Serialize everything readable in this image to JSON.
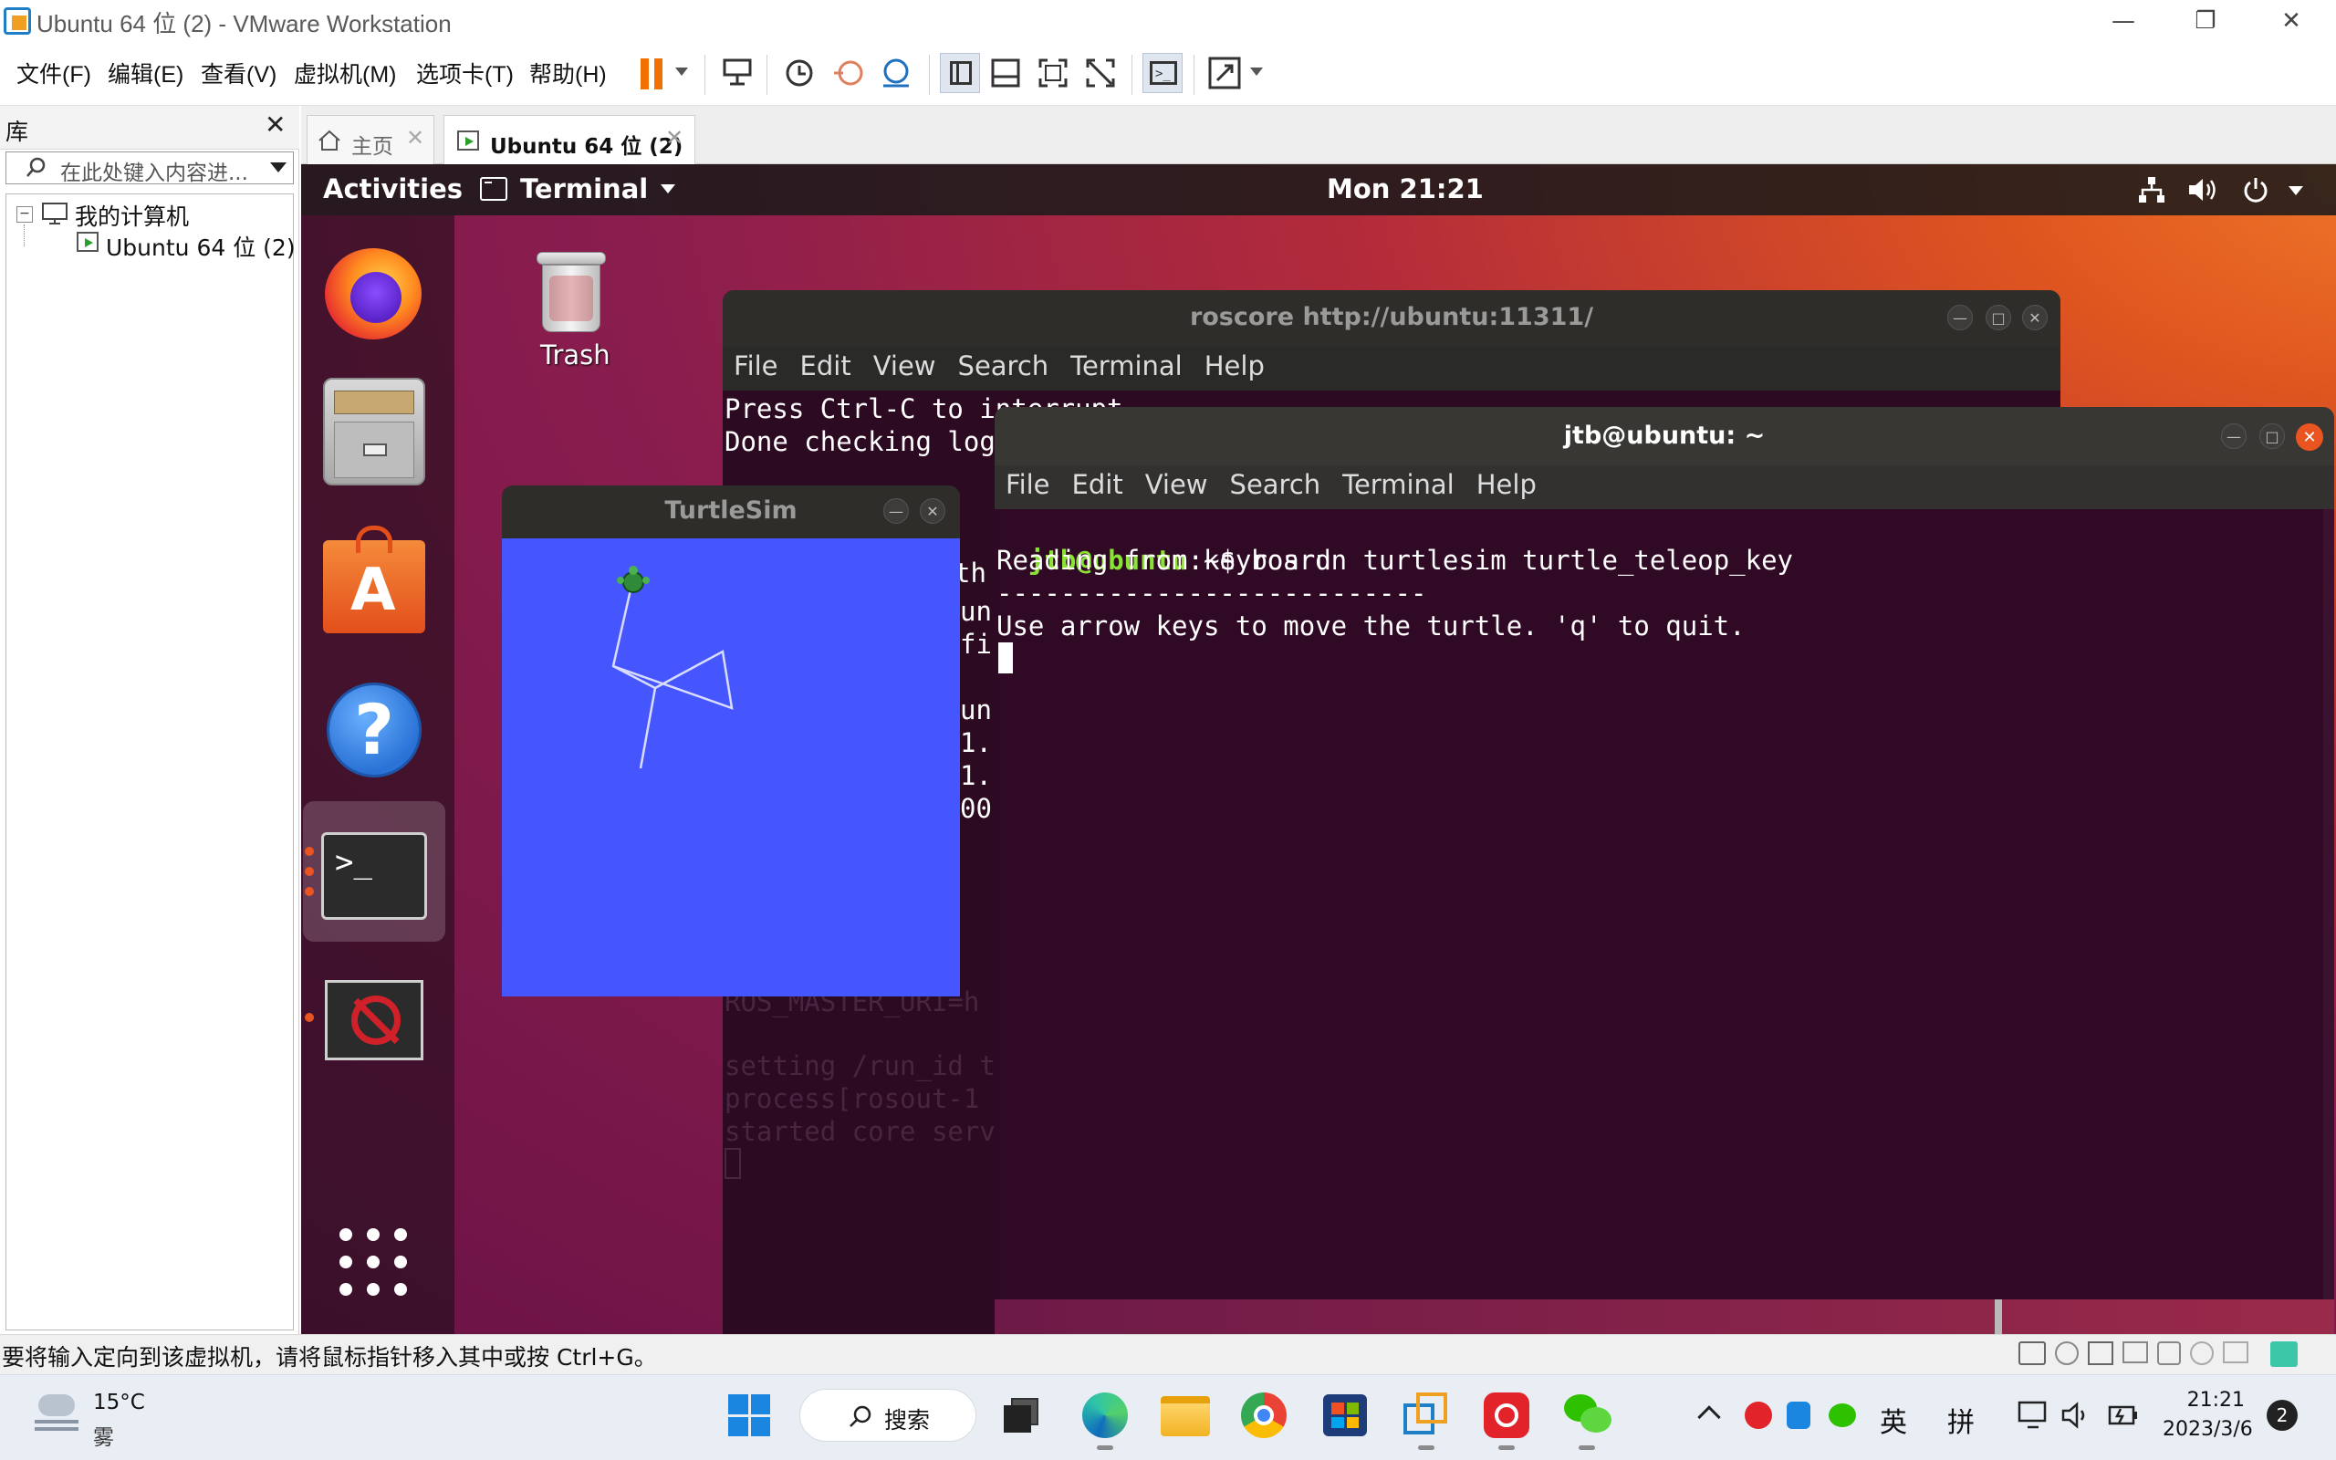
{
  "window": {
    "title": "Ubuntu 64 位 (2) - VMware Workstation"
  },
  "menubar": {
    "items": [
      "文件(F)",
      "编辑(E)",
      "查看(V)",
      "虚拟机(M)",
      "选项卡(T)",
      "帮助(H)"
    ]
  },
  "library": {
    "title": "库",
    "search_placeholder": "在此处键入内容进...",
    "tree_root": "我的计算机",
    "tree_child": "Ubuntu 64 位 (2)"
  },
  "tabs": [
    {
      "label": "主页"
    },
    {
      "label": "Ubuntu 64 位 (2)"
    }
  ],
  "ubuntu": {
    "activities": "Activities",
    "app_menu": "Terminal",
    "clock": "Mon 21:21",
    "trash_label": "Trash"
  },
  "roscore_window": {
    "title": "roscore http://ubuntu:11311/",
    "menu": [
      "File",
      "Edit",
      "View",
      "Search",
      "Terminal",
      "Help"
    ],
    "lines": [
      "Press Ctrl-C to interrupt",
      "Done checking log"
    ],
    "partial_fragments": [
      "th",
      "un",
      "fi",
      "un",
      "1.",
      "1.",
      "00"
    ],
    "ghost_lines": [
      "ROS_MASTER_URI=h",
      "",
      "setting /run_id t",
      "process[rosout-1",
      "started core serv"
    ]
  },
  "turtlesim_window": {
    "title": "TurtleSim",
    "bg_color": "#4556ff"
  },
  "teleop_window": {
    "title": "jtb@ubuntu: ~",
    "menu": [
      "File",
      "Edit",
      "View",
      "Search",
      "Terminal",
      "Help"
    ],
    "prompt_user": "jtb@ubuntu",
    "prompt_path": ":~$ ",
    "command": "rosrun turtlesim turtle_teleop_key",
    "output": [
      "Reading from keyboard",
      "---------------------------",
      "Use arrow keys to move the turtle. 'q' to quit."
    ]
  },
  "statusbar": {
    "text": "要将输入定向到该虚拟机，请将鼠标指针移入其中或按 Ctrl+G。"
  },
  "taskbar": {
    "weather_temp": "15°C",
    "weather_desc": "雾",
    "search_label": "搜索",
    "ime_lang": "英",
    "ime_mode": "拼",
    "time": "21:21",
    "date": "2023/3/6",
    "notification_count": "2"
  }
}
